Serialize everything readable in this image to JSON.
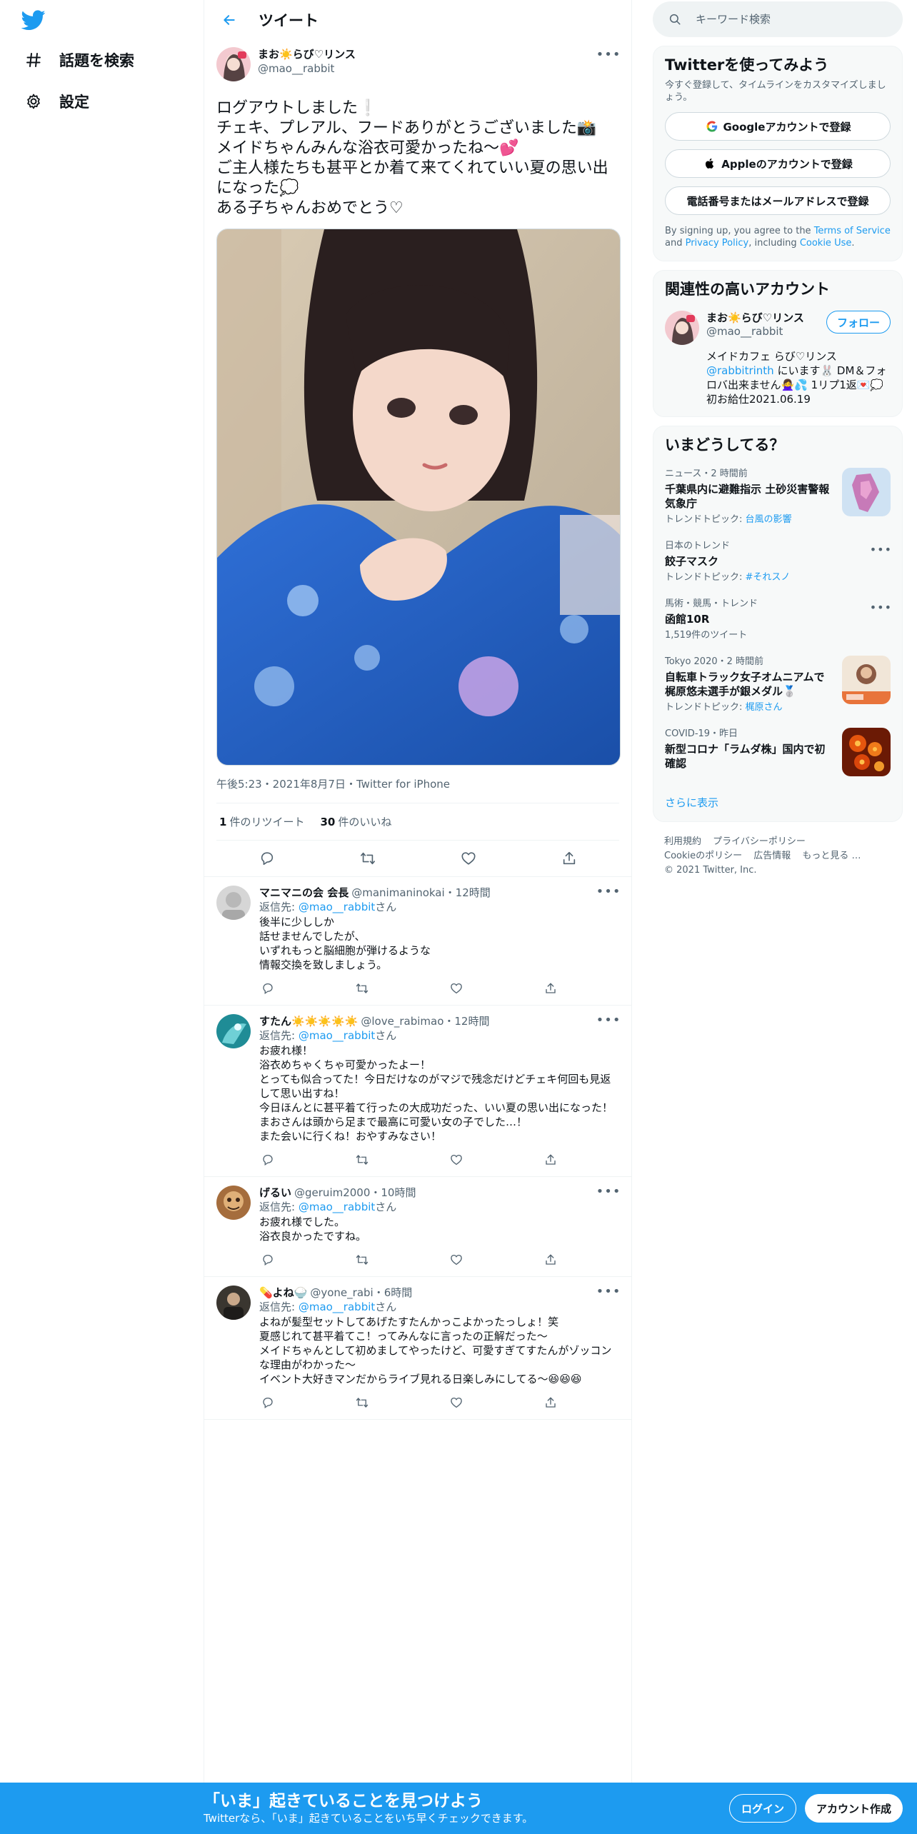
{
  "nav": {
    "logo_icon": "twitter-bird-icon",
    "items": [
      {
        "label": "話題を検索",
        "icon": "hashtag-icon"
      },
      {
        "label": "設定",
        "icon": "gear-icon"
      }
    ]
  },
  "header": {
    "title": "ツイート",
    "back_icon": "arrow-left-icon"
  },
  "main_tweet": {
    "name": "まお☀️らび♡リンス",
    "handle": "@mao__rabbit",
    "text": "ログアウトしました❕\nチェキ、プレアル、フードありがとうございました📸\nメイドちゃんみんな浴衣可愛かったね〜💕\nご主人様たちも甚平とか着て来てくれていい夏の思い出になった💭\nある子ちゃんおめでとう♡",
    "time": "午後5:23・2021年8月7日・Twitter for iPhone",
    "retweets": "1",
    "retweets_label": "件のリツイート",
    "likes": "30",
    "likes_label": "件のいいね"
  },
  "replies": [
    {
      "name": "マニマニの会 会長",
      "handle": "@manimaninokai・12時間",
      "to_prefix": "返信先: ",
      "to_user": "@mao__rabbit",
      "to_suffix": "さん",
      "text": "後半に少ししか\n話せませんでしたが、\nいずれもっと脳細胞が弾けるような\n情報交換を致しましょう。"
    },
    {
      "name": "すたん☀️☀️☀️☀️☀️",
      "handle": "@love_rabimao・12時間",
      "to_prefix": "返信先: ",
      "to_user": "@mao__rabbit",
      "to_suffix": "さん",
      "text": "お疲れ様！\n浴衣めちゃくちゃ可愛かったよー！\nとっても似合ってた！今日だけなのがマジで残念だけどチェキ何回も見返して思い出すね！\n今日ほんとに甚平着て行ったの大成功だった、いい夏の思い出になった！\nまおさんは頭から足まで最高に可愛い女の子でした…！\nまた会いに行くね！おやすみなさい！"
    },
    {
      "name": "げるい",
      "handle": "@geruim2000・10時間",
      "to_prefix": "返信先: ",
      "to_user": "@mao__rabbit",
      "to_suffix": "さん",
      "text": "お疲れ様でした。\n浴衣良かったですね。"
    },
    {
      "name": "💊よね🍚",
      "handle": "@yone_rabi・6時間",
      "to_prefix": "返信先: ",
      "to_user": "@mao__rabbit",
      "to_suffix": "さん",
      "text": "よねが髪型セットしてあげたすたんかっこよかったっしょ！笑\n夏感じれて甚平着てこ！ってみんなに言ったの正解だった〜\nメイドちゃんとして初めましてやったけど、可愛すぎてすたんがゾッコンな理由がわかった〜\nイベント大好きマンだからライブ見れる日楽しみにしてる〜😆😆😆"
    }
  ],
  "search": {
    "placeholder": "キーワード検索"
  },
  "signup_card": {
    "title": "Twitterを使ってみよう",
    "subtitle": "今すぐ登録して、タイムラインをカスタマイズしましょう。",
    "google": "Googleアカウントで登録",
    "apple": "Appleのアカウントで登録",
    "phone": "電話番号またはメールアドレスで登録",
    "legal_1": "By signing up, you agree to the ",
    "terms": "Terms of Service",
    "legal_2": " and ",
    "privacy": "Privacy Policy",
    "legal_3": ", including ",
    "cookie": "Cookie Use",
    "legal_4": "."
  },
  "related": {
    "title": "関連性の高いアカウント",
    "name": "まお☀️らび♡リンス",
    "handle": "@mao__rabbit",
    "follow": "フォロー",
    "bio_1": "メイドカフェ らび♡リンス",
    "bio_link": "@rabbitrinth",
    "bio_2": " にいます🐰 DM＆フォロバ出来ません🙅‍♀️💦 1リプ1返💌💭\n初お給仕2021.06.19"
  },
  "trends": {
    "title": "いまどうしてる？",
    "items": [
      {
        "meta": "ニュース・2 時間前",
        "title": "千葉県内に避難指示 土砂災害警報 気象庁",
        "sub_prefix": "トレンドトピック: ",
        "sub_link": "台風の影響"
      },
      {
        "meta": "日本のトレンド",
        "title": "餃子マスク",
        "sub_prefix": "トレンドトピック: ",
        "sub_link": "#それスノ"
      },
      {
        "meta": "馬術・競馬・トレンド",
        "title": "函館10R",
        "sub": "1,519件のツイート"
      },
      {
        "meta": "Tokyo 2020・2 時間前",
        "title": "自転車トラック女子オムニアムで梶原悠未選手が銀メダル🥈",
        "sub_prefix": "トレンドトピック: ",
        "sub_link": "梶原さん"
      },
      {
        "meta": "COVID-19・昨日",
        "title": "新型コロナ「ラムダ株」国内で初確認"
      }
    ],
    "show_more": "さらに表示"
  },
  "footer": {
    "links": [
      "利用規約",
      "プライバシーポリシー",
      "Cookieのポリシー",
      "広告情報",
      "もっと見る …"
    ],
    "copyright": "© 2021 Twitter, Inc."
  },
  "banner": {
    "title": "「いま」起きていることを見つけよう",
    "subtitle": "Twitterなら、「いま」起きていることをいち早くチェックできます。",
    "login": "ログイン",
    "signup": "アカウント作成"
  },
  "colors": {
    "accent": "#1d9bf0",
    "text": "#0f1419",
    "muted": "#536471"
  }
}
